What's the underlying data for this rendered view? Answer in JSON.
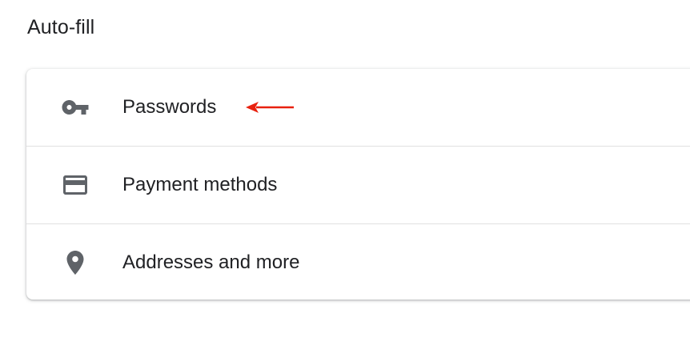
{
  "section": {
    "title": "Auto-fill"
  },
  "autofill": {
    "items": [
      {
        "label": "Passwords",
        "icon": "key-icon"
      },
      {
        "label": "Payment methods",
        "icon": "credit-card-icon"
      },
      {
        "label": "Addresses and more",
        "icon": "location-pin-icon"
      }
    ]
  },
  "colors": {
    "icon": "#5f6368",
    "text": "#202124",
    "divider": "#e0e0e0",
    "annotation_arrow": "#e8210f"
  }
}
